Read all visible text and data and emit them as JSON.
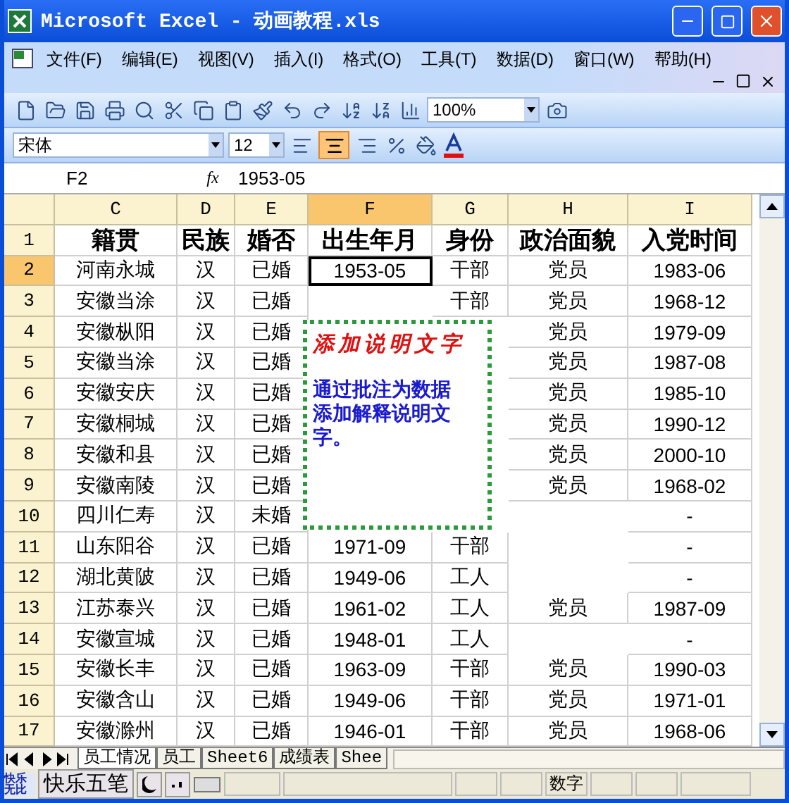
{
  "window": {
    "title": "Microsoft Excel - 动画教程.xls"
  },
  "menu": [
    "文件(F)",
    "编辑(E)",
    "视图(V)",
    "插入(I)",
    "格式(O)",
    "工具(T)",
    "数据(D)",
    "窗口(W)",
    "帮助(H)"
  ],
  "toolbar": {
    "zoom": "100%"
  },
  "format_bar": {
    "font": "宋体",
    "size": "12",
    "align_center_on": true
  },
  "formula_bar": {
    "name_box": "F2",
    "fx": "fx",
    "value": "1953-05"
  },
  "columns": [
    {
      "letter": "C",
      "selected": false
    },
    {
      "letter": "D",
      "selected": false
    },
    {
      "letter": "E",
      "selected": false
    },
    {
      "letter": "F",
      "selected": true
    },
    {
      "letter": "G",
      "selected": false
    },
    {
      "letter": "H",
      "selected": false
    },
    {
      "letter": "I",
      "selected": false
    }
  ],
  "rows": [
    {
      "number": "1",
      "kind": "header",
      "selected": false,
      "cells": [
        "籍贯",
        "民族",
        "婚否",
        "出生年月",
        "身份",
        "政治面貌",
        "入党时间"
      ]
    },
    {
      "number": "2",
      "kind": "data",
      "selected": true,
      "cells": [
        "河南永城",
        "汉",
        "已婚",
        "1953-05",
        "干部",
        "党员",
        "1983-06"
      ]
    },
    {
      "number": "3",
      "kind": "data",
      "selected": false,
      "cells": [
        "安徽当涂",
        "汉",
        "已婚",
        null,
        "干部",
        "党员",
        "1968-12"
      ]
    },
    {
      "number": "4",
      "kind": "data",
      "selected": false,
      "cells": [
        "安徽枞阳",
        "汉",
        "已婚",
        null,
        null,
        "党员",
        "1979-09"
      ]
    },
    {
      "number": "5",
      "kind": "data",
      "selected": false,
      "cells": [
        "安徽当涂",
        "汉",
        "已婚",
        null,
        null,
        "党员",
        "1987-08"
      ]
    },
    {
      "number": "6",
      "kind": "data",
      "selected": false,
      "cells": [
        "安徽安庆",
        "汉",
        "已婚",
        null,
        null,
        "党员",
        "1985-10"
      ]
    },
    {
      "number": "7",
      "kind": "data",
      "selected": false,
      "cells": [
        "安徽桐城",
        "汉",
        "已婚",
        null,
        null,
        "党员",
        "1990-12"
      ]
    },
    {
      "number": "8",
      "kind": "data",
      "selected": false,
      "cells": [
        "安徽和县",
        "汉",
        "已婚",
        null,
        null,
        "党员",
        "2000-10"
      ]
    },
    {
      "number": "9",
      "kind": "data",
      "selected": false,
      "cells": [
        "安徽南陵",
        "汉",
        "已婚",
        null,
        null,
        "党员",
        "1968-02"
      ]
    },
    {
      "number": "10",
      "kind": "data",
      "selected": false,
      "cells": [
        "四川仁寿",
        "汉",
        "未婚",
        null,
        null,
        null,
        "-"
      ]
    },
    {
      "number": "11",
      "kind": "data",
      "selected": false,
      "cells": [
        "山东阳谷",
        "汉",
        "已婚",
        "1971-09",
        "干部",
        null,
        "-"
      ]
    },
    {
      "number": "12",
      "kind": "data",
      "selected": false,
      "cells": [
        "湖北黄陂",
        "汉",
        "已婚",
        "1949-06",
        "工人",
        null,
        "-"
      ]
    },
    {
      "number": "13",
      "kind": "data",
      "selected": false,
      "cells": [
        "江苏泰兴",
        "汉",
        "已婚",
        "1961-02",
        "工人",
        "党员",
        "1987-09"
      ]
    },
    {
      "number": "14",
      "kind": "data",
      "selected": false,
      "cells": [
        "安徽宣城",
        "汉",
        "已婚",
        "1948-01",
        "工人",
        null,
        "-"
      ]
    },
    {
      "number": "15",
      "kind": "data",
      "selected": false,
      "cells": [
        "安徽长丰",
        "汉",
        "已婚",
        "1963-09",
        "干部",
        "党员",
        "1990-03"
      ]
    },
    {
      "number": "16",
      "kind": "data",
      "selected": false,
      "cells": [
        "安徽含山",
        "汉",
        "已婚",
        "1949-06",
        "干部",
        "党员",
        "1971-01"
      ]
    },
    {
      "number": "17",
      "kind": "data",
      "selected": false,
      "cells": [
        "安徽滁州",
        "汉",
        "已婚",
        "1946-01",
        "干部",
        "党员",
        "1968-06"
      ]
    }
  ],
  "comment": {
    "title": "添加说明文字",
    "body": "通过批注为数据添加解释说明文字。"
  },
  "sheet_tabs": [
    {
      "label": "员工情况",
      "selected": true
    },
    {
      "label": "员工",
      "selected": false
    },
    {
      "label": "Sheet6",
      "selected": false
    },
    {
      "label": "成绩表",
      "selected": false
    },
    {
      "label": "Shee",
      "selected": false
    }
  ],
  "status_bar": {
    "ime_logo": "快乐无比",
    "ime_name": "快乐五笔",
    "mode": "数字"
  }
}
